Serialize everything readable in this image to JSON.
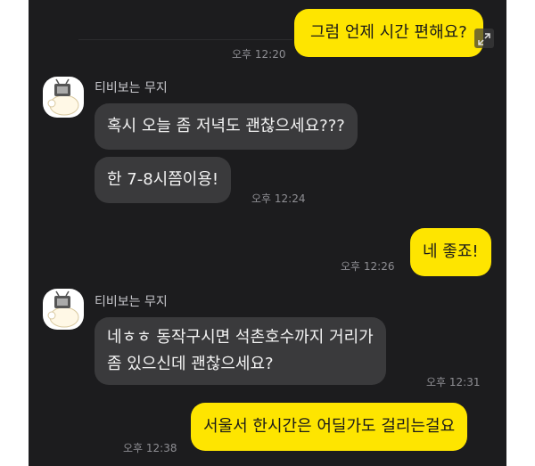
{
  "messages": [
    {
      "sender": "me",
      "text": "그럼 언제 시간 편해요?",
      "time": "오후 12:20"
    },
    {
      "sender": "티비보는 무지",
      "text": "혹시 오늘 좀 저녁도 괜찮으세요???"
    },
    {
      "sender": "티비보는 무지",
      "text": "한 7-8시쯤이용!",
      "time": "오후 12:24"
    },
    {
      "sender": "me",
      "text": "네 좋죠!",
      "time": "오후 12:26"
    },
    {
      "sender": "티비보는 무지",
      "text_lines": [
        "네ㅎㅎ 동작구시면 석촌호수까지 거리가",
        "좀 있으신데 괜찮으세요?"
      ],
      "time": "오후 12:31"
    },
    {
      "sender": "me",
      "text": "서울서 한시간은 어딜가도 걸리는걸요",
      "time": "오후 12:38"
    }
  ],
  "contact": {
    "name": "티비보는 무지",
    "avatar": "muzi-tv-avatar"
  },
  "icons": {
    "expand": "expand-icon"
  },
  "colors": {
    "background": "#1c1c1e",
    "outgoing": "#fee500",
    "incoming": "#3a3a3c",
    "time": "#8e8e93"
  }
}
